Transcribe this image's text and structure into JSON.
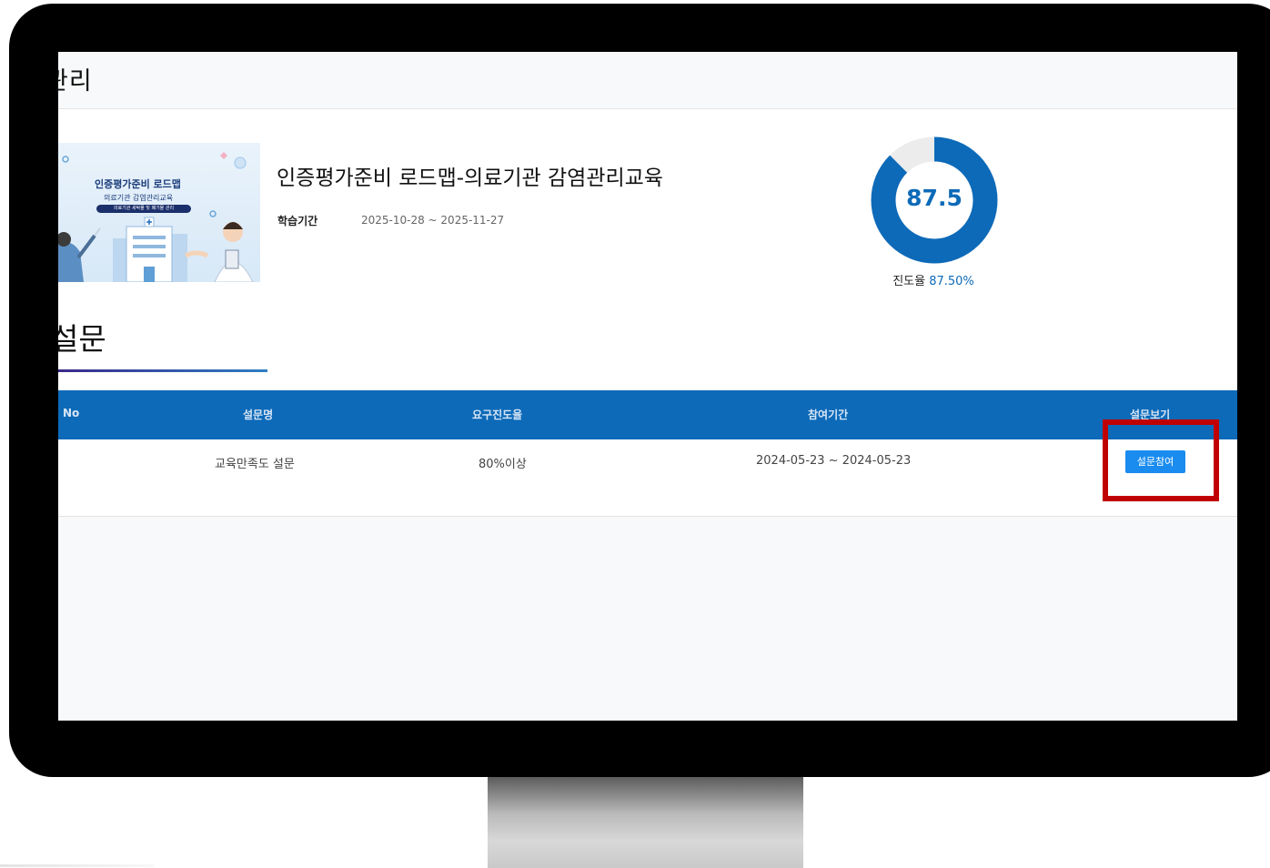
{
  "page": {
    "title": "관리"
  },
  "course": {
    "thumbnail_title": "인증평가준비 로드맵",
    "thumbnail_subtitle": "의료기관 감염관리교육",
    "thumbnail_pill": "의료기관 세탁물 및 폐기물 관리",
    "title": "인증평가준비 로드맵-의료기관 감염관리교육",
    "period_label": "학습기간",
    "period_value": "2025-10-28 ~ 2025-11-27"
  },
  "progress": {
    "percent": 87.5,
    "center_label": "87.5",
    "caption_label": "진도율",
    "caption_value": "87.50%",
    "ring_color": "#0d6ab8",
    "track_color": "#ececec"
  },
  "survey": {
    "section_title": "설문",
    "columns": [
      "No",
      "설문명",
      "요구진도율",
      "참여기간",
      "설문보기"
    ],
    "rows": [
      {
        "no": "",
        "name": "교육만족도 설문",
        "required_progress": "80%이상",
        "period": "2024-05-23 ~ 2024-05-23",
        "action_label": "설문참여"
      }
    ]
  },
  "colors": {
    "header_blue": "#0d6ab8",
    "button_blue": "#1a8cf0",
    "highlight_red": "#c00000"
  }
}
